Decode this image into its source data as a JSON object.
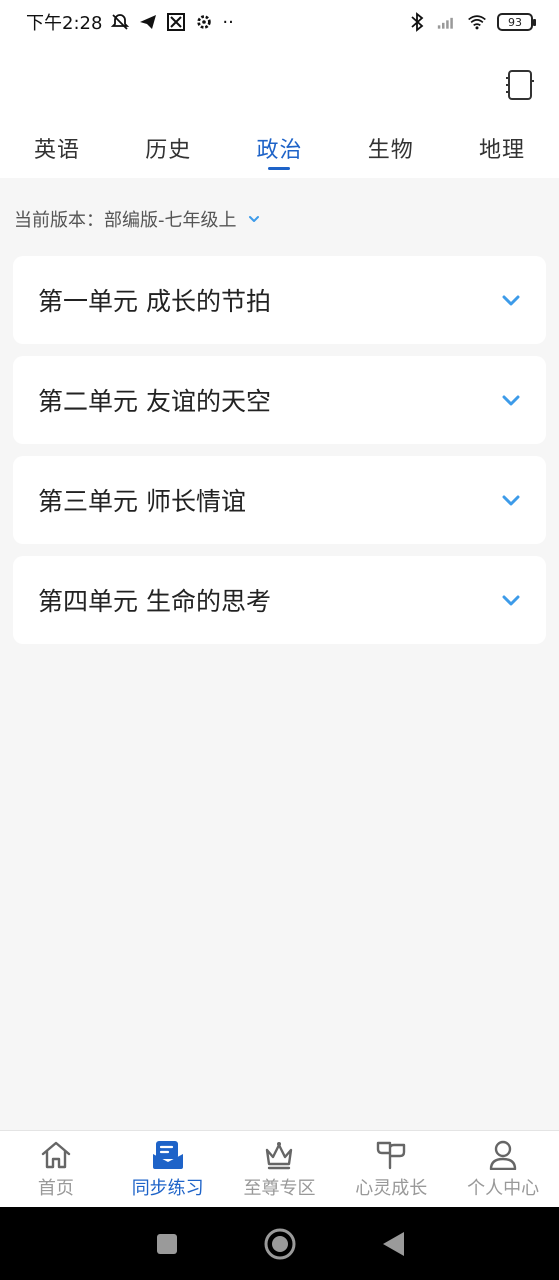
{
  "status_bar": {
    "time": "下午2:28",
    "battery_level": "93",
    "icons": [
      "mute-icon",
      "telegram-icon",
      "app-icon",
      "settings-icon",
      "more-icon",
      "bluetooth-icon",
      "signal-icon",
      "wifi-icon",
      "battery-icon"
    ],
    "more": "··"
  },
  "header": {
    "notebook_icon": "notebook-icon"
  },
  "tabs": [
    {
      "label": "英语",
      "active": false
    },
    {
      "label": "历史",
      "active": false
    },
    {
      "label": "政治",
      "active": true
    },
    {
      "label": "生物",
      "active": false
    },
    {
      "label": "地理",
      "active": false
    }
  ],
  "version": {
    "label": "当前版本：部编版-七年级上"
  },
  "units": [
    {
      "title": "第一单元 成长的节拍"
    },
    {
      "title": "第二单元 友谊的天空"
    },
    {
      "title": "第三单元 师长情谊"
    },
    {
      "title": "第四单元 生命的思考"
    }
  ],
  "bottom_nav": [
    {
      "label": "首页",
      "icon": "home-icon",
      "active": false
    },
    {
      "label": "同步练习",
      "icon": "practice-icon",
      "active": true
    },
    {
      "label": "至尊专区",
      "icon": "crown-icon",
      "active": false
    },
    {
      "label": "心灵成长",
      "icon": "sprout-icon",
      "active": false
    },
    {
      "label": "个人中心",
      "icon": "person-icon",
      "active": false
    }
  ],
  "colors": {
    "accent": "#1e63c8",
    "chevron": "#3d9be9",
    "background": "#f6f6f6",
    "inactive_nav": "#999999"
  }
}
